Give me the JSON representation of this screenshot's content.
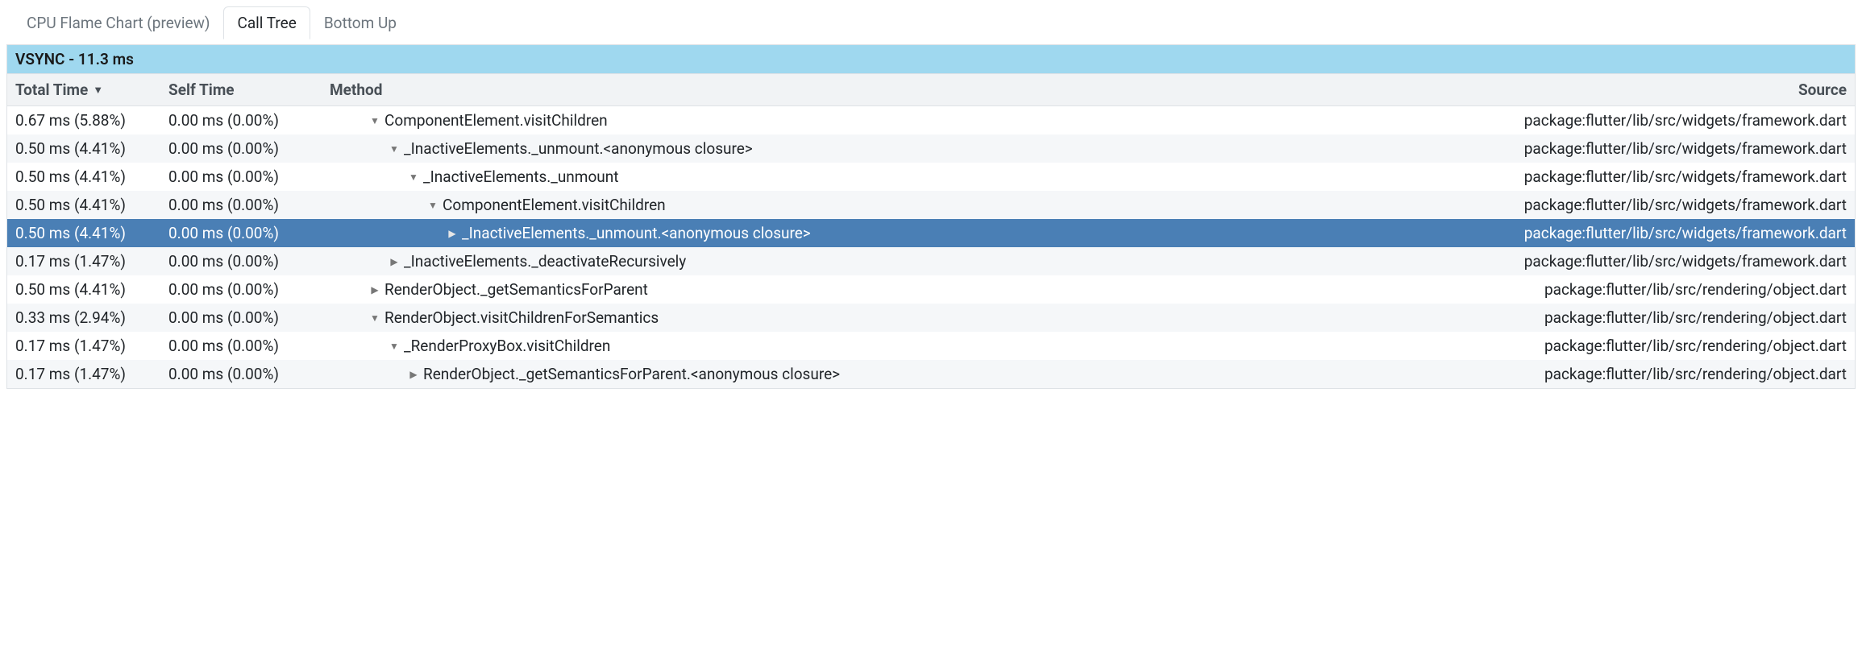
{
  "tabs": {
    "flame": "CPU Flame Chart (preview)",
    "calltree": "Call Tree",
    "bottomup": "Bottom Up"
  },
  "banner": "VSYNC - 11.3 ms",
  "columns": {
    "total": "Total Time",
    "self": "Self Time",
    "method": "Method",
    "source": "Source"
  },
  "sort_indicator": "▼",
  "rows": [
    {
      "total": "0.67 ms (5.88%)",
      "self": "0.00 ms (0.00%)",
      "indent": 1,
      "arrow": "down",
      "method": "ComponentElement.visitChildren",
      "source": "package:flutter/lib/src/widgets/framework.dart",
      "selected": false
    },
    {
      "total": "0.50 ms (4.41%)",
      "self": "0.00 ms (0.00%)",
      "indent": 2,
      "arrow": "down",
      "method": "_InactiveElements._unmount.<anonymous closure>",
      "source": "package:flutter/lib/src/widgets/framework.dart",
      "selected": false
    },
    {
      "total": "0.50 ms (4.41%)",
      "self": "0.00 ms (0.00%)",
      "indent": 3,
      "arrow": "down",
      "method": "_InactiveElements._unmount",
      "source": "package:flutter/lib/src/widgets/framework.dart",
      "selected": false
    },
    {
      "total": "0.50 ms (4.41%)",
      "self": "0.00 ms (0.00%)",
      "indent": 4,
      "arrow": "down",
      "method": "ComponentElement.visitChildren",
      "source": "package:flutter/lib/src/widgets/framework.dart",
      "selected": false
    },
    {
      "total": "0.50 ms (4.41%)",
      "self": "0.00 ms (0.00%)",
      "indent": 5,
      "arrow": "right",
      "method": "_InactiveElements._unmount.<anonymous closure>",
      "source": "package:flutter/lib/src/widgets/framework.dart",
      "selected": true
    },
    {
      "total": "0.17 ms (1.47%)",
      "self": "0.00 ms (0.00%)",
      "indent": 2,
      "arrow": "right",
      "method": "_InactiveElements._deactivateRecursively",
      "source": "package:flutter/lib/src/widgets/framework.dart",
      "selected": false
    },
    {
      "total": "0.50 ms (4.41%)",
      "self": "0.00 ms (0.00%)",
      "indent": 1,
      "arrow": "right",
      "method": "RenderObject._getSemanticsForParent",
      "source": "package:flutter/lib/src/rendering/object.dart",
      "selected": false
    },
    {
      "total": "0.33 ms (2.94%)",
      "self": "0.00 ms (0.00%)",
      "indent": 1,
      "arrow": "down",
      "method": "RenderObject.visitChildrenForSemantics",
      "source": "package:flutter/lib/src/rendering/object.dart",
      "selected": false
    },
    {
      "total": "0.17 ms (1.47%)",
      "self": "0.00 ms (0.00%)",
      "indent": 2,
      "arrow": "down",
      "method": "_RenderProxyBox.visitChildren",
      "source": "package:flutter/lib/src/rendering/object.dart",
      "selected": false
    },
    {
      "total": "0.17 ms (1.47%)",
      "self": "0.00 ms (0.00%)",
      "indent": 3,
      "arrow": "right",
      "method": "RenderObject._getSemanticsForParent.<anonymous closure>",
      "source": "package:flutter/lib/src/rendering/object.dart",
      "selected": false
    }
  ]
}
